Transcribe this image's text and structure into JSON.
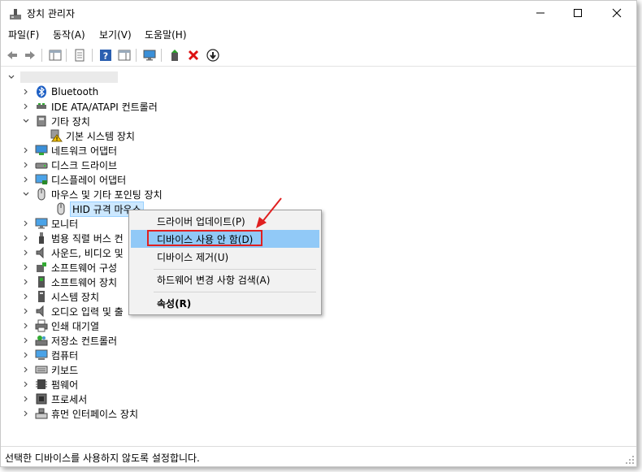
{
  "window": {
    "title": "장치 관리자"
  },
  "menu": [
    {
      "label": "파일(F)"
    },
    {
      "label": "동작(A)"
    },
    {
      "label": "보기(V)"
    },
    {
      "label": "도움말(H)"
    }
  ],
  "tree": {
    "items": [
      {
        "label": "Bluetooth",
        "icon": "bluetooth-icon"
      },
      {
        "label": "IDE ATA/ATAPI 컨트롤러",
        "icon": "ide-controller-icon"
      },
      {
        "label": "기타 장치",
        "icon": "other-devices-icon"
      },
      {
        "label": "기본 시스템 장치",
        "icon": "warning-device-icon"
      },
      {
        "label": "네트워크 어댑터",
        "icon": "network-adapter-icon"
      },
      {
        "label": "디스크 드라이브",
        "icon": "disk-drive-icon"
      },
      {
        "label": "디스플레이 어댑터",
        "icon": "display-adapter-icon"
      },
      {
        "label": "마우스 및 기타 포인팅 장치",
        "icon": "mouse-icon"
      },
      {
        "label": "HID 규격 마우스",
        "icon": "mouse-icon"
      },
      {
        "label": "모니터",
        "icon": "monitor-icon"
      },
      {
        "label": "범용 직렬 버스 컨",
        "icon": "usb-icon"
      },
      {
        "label": "사운드, 비디오 및",
        "icon": "speaker-icon"
      },
      {
        "label": "소프트웨어 구성",
        "icon": "software-component-icon"
      },
      {
        "label": "소프트웨어 장치",
        "icon": "software-device-icon"
      },
      {
        "label": "시스템 장치",
        "icon": "system-device-icon"
      },
      {
        "label": "오디오 입력 및 출",
        "icon": "audio-icon"
      },
      {
        "label": "인쇄 대기열",
        "icon": "printer-icon"
      },
      {
        "label": "저장소 컨트롤러",
        "icon": "storage-controller-icon"
      },
      {
        "label": "컴퓨터",
        "icon": "computer-icon"
      },
      {
        "label": "키보드",
        "icon": "keyboard-icon"
      },
      {
        "label": "펌웨어",
        "icon": "firmware-icon"
      },
      {
        "label": "프로세서",
        "icon": "processor-icon"
      },
      {
        "label": "휴먼 인터페이스 장치",
        "icon": "hid-icon"
      }
    ]
  },
  "context_menu": {
    "items": [
      {
        "label": "드라이버 업데이트(P)"
      },
      {
        "label": "디바이스 사용 안 함(D)"
      },
      {
        "label": "디바이스 제거(U)"
      },
      {
        "label": "하드웨어 변경 사항 검색(A)"
      },
      {
        "label": "속성(R)"
      }
    ]
  },
  "status": {
    "text": "선택한 디바이스를 사용하지 않도록 설정합니다."
  },
  "colors": {
    "highlight": "#91c9f7",
    "annotation": "#e02020",
    "selection": "#cce8ff"
  }
}
